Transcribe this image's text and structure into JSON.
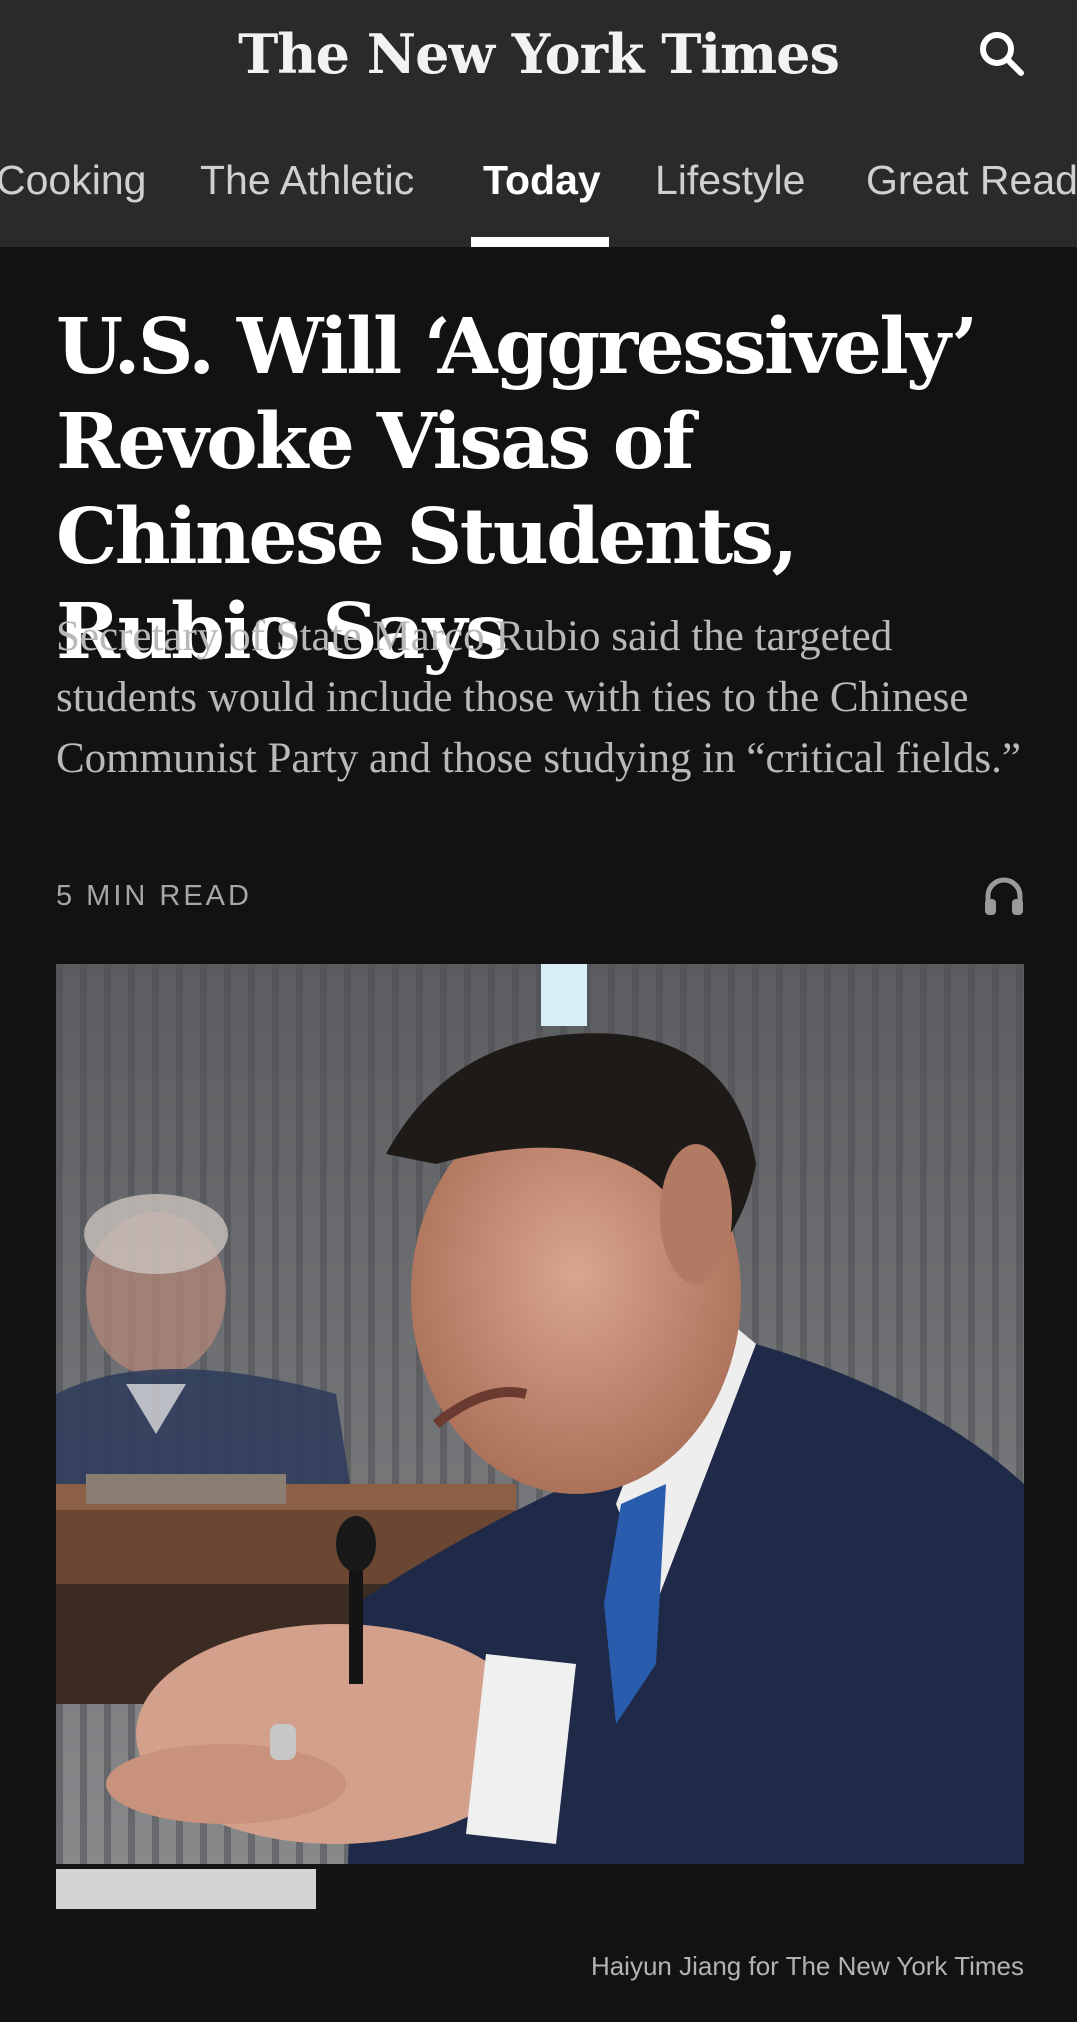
{
  "header": {
    "masthead": "The New York Times",
    "search_icon": "search-icon"
  },
  "nav": {
    "tabs": [
      {
        "label": "Cooking",
        "active": false
      },
      {
        "label": "The Athletic",
        "active": false
      },
      {
        "label": "Today",
        "active": true
      },
      {
        "label": "Lifestyle",
        "active": false
      },
      {
        "label": "Great Read",
        "active": false
      }
    ]
  },
  "article": {
    "headline": "U.S. Will ‘Aggressively’ Revoke Visas of Chinese Students, Rubio Says",
    "summary": "Secretary of State Marco Rubio said the targeted students would include those with ties to the Chinese Communist Party and those studying in “critical fields.”",
    "read_time": "5 MIN READ",
    "audio_icon": "headphones-icon",
    "photo_credit": "Haiyun Jiang for The New York Times"
  },
  "colors": {
    "background": "#121212",
    "header": "#2a2a2a",
    "text_primary": "#ffffff",
    "text_secondary": "#b9b9b9"
  }
}
